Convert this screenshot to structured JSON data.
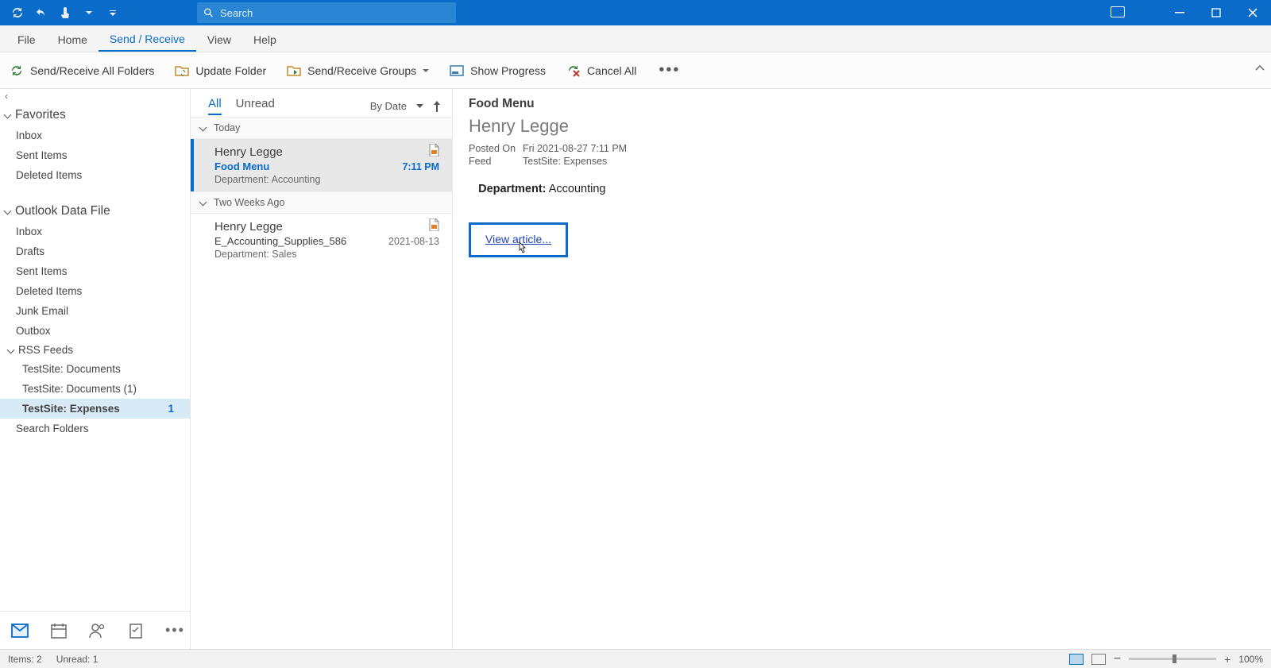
{
  "titlebar": {
    "search_placeholder": "Search"
  },
  "tabs": [
    "File",
    "Home",
    "Send / Receive",
    "View",
    "Help"
  ],
  "active_tab_index": 2,
  "ribbon": {
    "send_receive_all": "Send/Receive All Folders",
    "update_folder": "Update Folder",
    "send_receive_groups": "Send/Receive Groups",
    "show_progress": "Show Progress",
    "cancel_all": "Cancel All"
  },
  "folderpane": {
    "favorites": {
      "title": "Favorites",
      "items": [
        "Inbox",
        "Sent Items",
        "Deleted Items"
      ]
    },
    "datafile": {
      "title": "Outlook Data File",
      "items": [
        "Inbox",
        "Drafts",
        "Sent Items",
        "Deleted Items",
        "Junk Email",
        "Outbox"
      ],
      "rss": {
        "title": "RSS Feeds",
        "items": [
          {
            "name": "TestSite: Documents",
            "count": null,
            "selected": false
          },
          {
            "name": "TestSite: Documents (1)",
            "count": null,
            "selected": false
          },
          {
            "name": "TestSite: Expenses",
            "count": "1",
            "selected": true
          }
        ]
      },
      "search_folders": "Search Folders"
    }
  },
  "msglist": {
    "filters": {
      "all": "All",
      "unread": "Unread"
    },
    "sort_label": "By Date",
    "groups": [
      {
        "label": "Today",
        "items": [
          {
            "from": "Henry Legge",
            "subject": "Food Menu",
            "preview": "Department: Accounting",
            "time": "7:11 PM",
            "selected": true,
            "unread": true
          }
        ]
      },
      {
        "label": "Two Weeks Ago",
        "items": [
          {
            "from": "Henry Legge",
            "subject": "E_Accounting_Supplies_586",
            "preview": "Department: Sales",
            "time": "2021-08-13",
            "selected": false,
            "unread": false
          }
        ]
      }
    ]
  },
  "reading": {
    "subject": "Food Menu",
    "sender": "Henry Legge",
    "posted_label": "Posted On",
    "posted_value": "Fri 2021-08-27 7:11 PM",
    "feed_label": "Feed",
    "feed_value": "TestSite: Expenses",
    "body_label": "Department:",
    "body_value": "Accounting",
    "view_article": "View article..."
  },
  "statusbar": {
    "items": "Items: 2",
    "unread": "Unread: 1",
    "zoom": "100%"
  }
}
